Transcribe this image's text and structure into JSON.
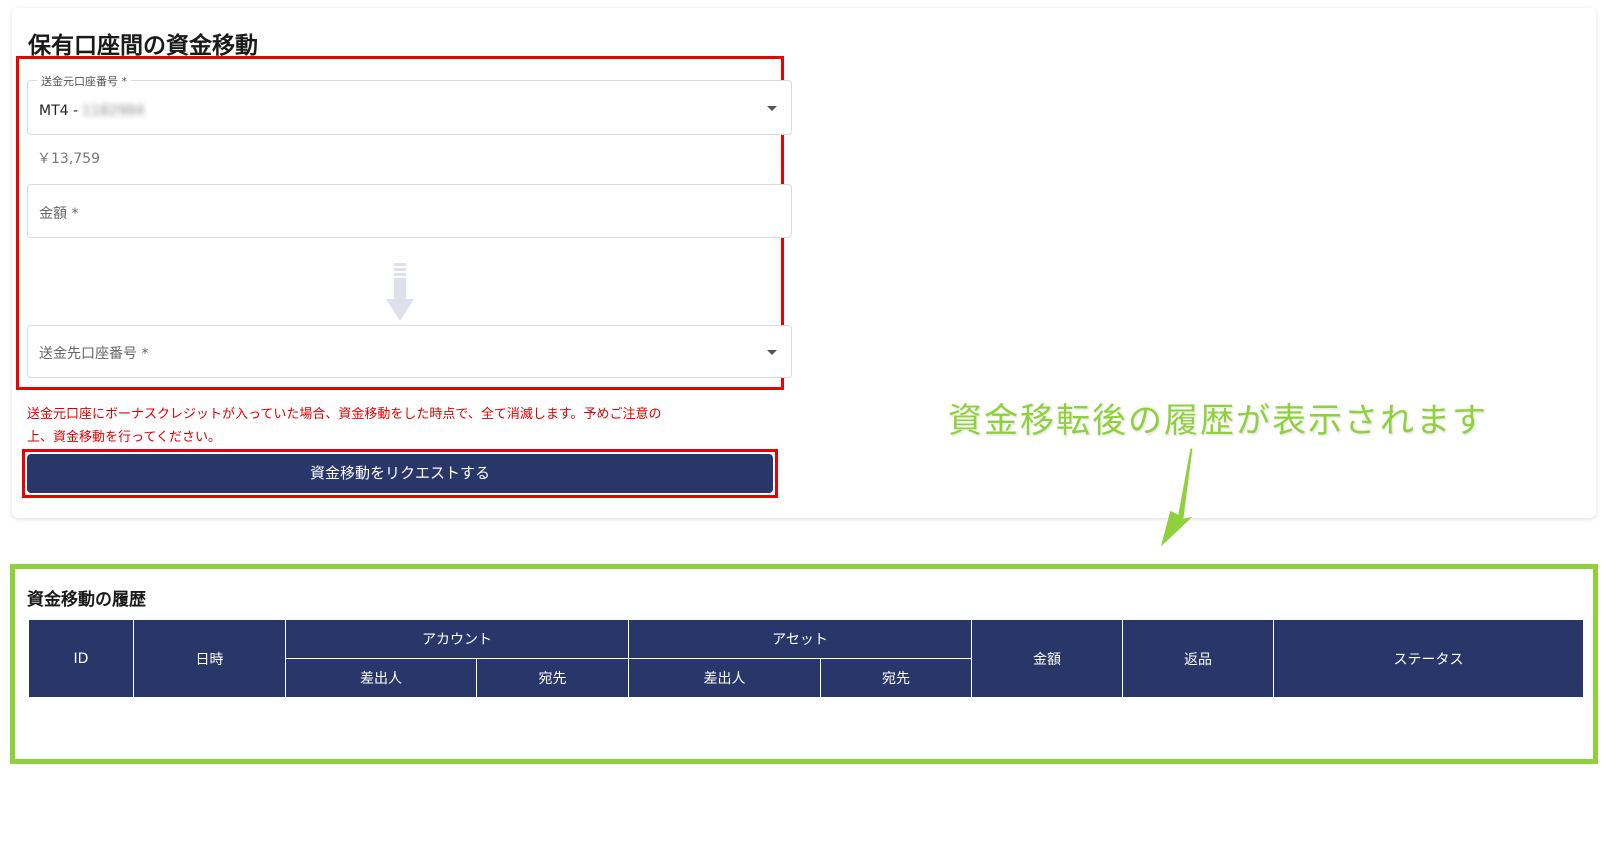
{
  "page_title": "保有口座間の資金移動",
  "from_account": {
    "label": "送金元口座番号 *",
    "value_prefix": "MT4 -",
    "value_masked": "1182984",
    "dropdown_icon": "chevron-down-icon",
    "balance": "￥13,759"
  },
  "amount": {
    "placeholder": "金額 *"
  },
  "transfer_arrow_icon": "arrow-down-icon",
  "to_account": {
    "placeholder": "送金先口座番号 *",
    "dropdown_icon": "chevron-down-icon"
  },
  "warning_line1": "送金元口座にボーナスクレジットが入っていた場合、資金移動をした時点で、全て消滅します。予めご注意の",
  "warning_line2": "上、資金移動を行ってください。",
  "submit_label": "資金移動をリクエストする",
  "annotation_text": "資金移転後の履歴が表示されます",
  "history": {
    "title": "資金移動の履歴",
    "headers": {
      "id": "ID",
      "datetime": "日時",
      "account": "アカウント",
      "asset": "アセット",
      "amount": "金額",
      "refund": "返品",
      "status": "ステータス",
      "sender": "差出人",
      "recipient": "宛先"
    }
  },
  "colors": {
    "primary": "#29366a",
    "highlight_red": "#ee0000",
    "highlight_green": "#8fd13c",
    "warning_text": "#e00000"
  }
}
